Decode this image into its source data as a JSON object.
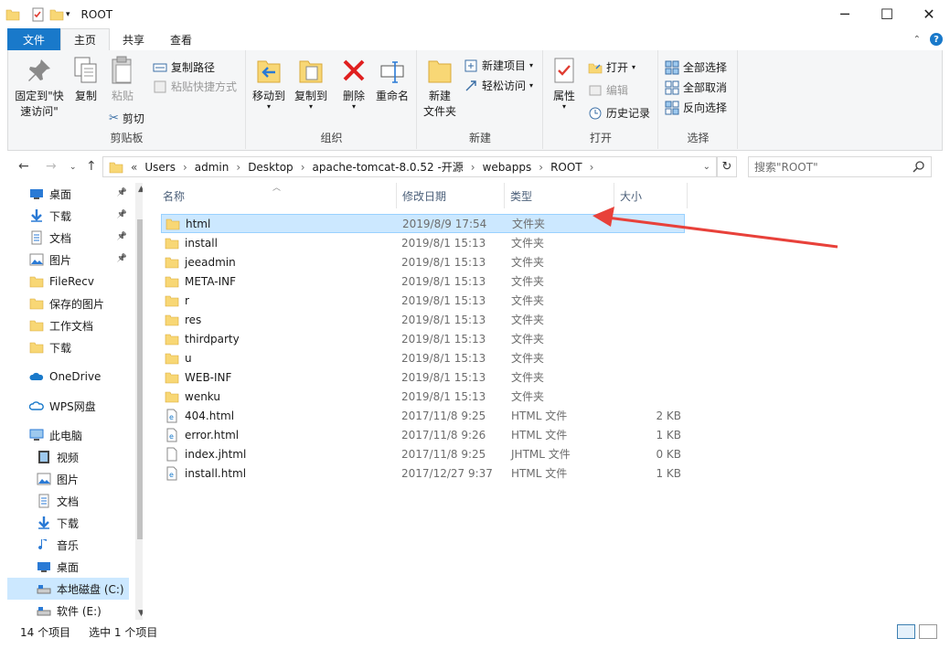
{
  "window": {
    "title": "ROOT",
    "minimize": "─",
    "maximize": "☐",
    "close": "✕"
  },
  "tabs": [
    "文件",
    "主页",
    "共享",
    "查看"
  ],
  "ribbon": {
    "clipboard": {
      "label": "剪贴板",
      "pin": "固定到\"快速访问\"",
      "copy": "复制",
      "paste": "粘贴",
      "copy_path": "复制路径",
      "paste_shortcut": "粘贴快捷方式",
      "cut": "剪切"
    },
    "organize": {
      "label": "组织",
      "move_to": "移动到",
      "copy_to": "复制到",
      "delete": "删除",
      "rename": "重命名"
    },
    "new": {
      "label": "新建",
      "new_folder": "新建\n文件夹",
      "new_item": "新建项目",
      "easy_access": "轻松访问"
    },
    "open": {
      "label": "打开",
      "properties": "属性",
      "open": "打开",
      "edit": "编辑",
      "history": "历史记录"
    },
    "select": {
      "label": "选择",
      "select_all": "全部选择",
      "select_none": "全部取消",
      "invert": "反向选择"
    }
  },
  "address": {
    "prefix": "«",
    "crumbs": [
      "Users",
      "admin",
      "Desktop",
      "apache-tomcat-8.0.52 -开源",
      "webapps",
      "ROOT"
    ],
    "search_placeholder": "搜索\"ROOT\""
  },
  "nav": {
    "quick": [
      {
        "label": "桌面",
        "icon": "desktop-icon",
        "pinned": true
      },
      {
        "label": "下载",
        "icon": "download-icon",
        "pinned": true
      },
      {
        "label": "文档",
        "icon": "document-icon",
        "pinned": true
      },
      {
        "label": "图片",
        "icon": "picture-icon",
        "pinned": true
      },
      {
        "label": "FileRecv",
        "icon": "folder-icon",
        "pinned": false
      },
      {
        "label": "保存的图片",
        "icon": "folder-icon",
        "pinned": false
      },
      {
        "label": "工作文档",
        "icon": "folder-icon",
        "pinned": false
      },
      {
        "label": "下载",
        "icon": "folder-icon",
        "pinned": false
      }
    ],
    "onedrive": "OneDrive",
    "wps": "WPS网盘",
    "thispc": "此电脑",
    "pc": [
      {
        "label": "视频",
        "icon": "video-icon"
      },
      {
        "label": "图片",
        "icon": "picture-icon"
      },
      {
        "label": "文档",
        "icon": "document-icon"
      },
      {
        "label": "下载",
        "icon": "download-icon"
      },
      {
        "label": "音乐",
        "icon": "music-icon"
      },
      {
        "label": "桌面",
        "icon": "desktop-icon"
      },
      {
        "label": "本地磁盘 (C:)",
        "icon": "drive-icon"
      },
      {
        "label": "软件 (E:)",
        "icon": "drive-icon"
      }
    ]
  },
  "columns": [
    "名称",
    "修改日期",
    "类型",
    "大小"
  ],
  "files": [
    {
      "name": "html",
      "date": "2019/8/9 17:54",
      "type": "文件夹",
      "size": "",
      "kind": "folder",
      "selected": true
    },
    {
      "name": "install",
      "date": "2019/8/1 15:13",
      "type": "文件夹",
      "size": "",
      "kind": "folder"
    },
    {
      "name": "jeeadmin",
      "date": "2019/8/1 15:13",
      "type": "文件夹",
      "size": "",
      "kind": "folder"
    },
    {
      "name": "META-INF",
      "date": "2019/8/1 15:13",
      "type": "文件夹",
      "size": "",
      "kind": "folder"
    },
    {
      "name": "r",
      "date": "2019/8/1 15:13",
      "type": "文件夹",
      "size": "",
      "kind": "folder"
    },
    {
      "name": "res",
      "date": "2019/8/1 15:13",
      "type": "文件夹",
      "size": "",
      "kind": "folder"
    },
    {
      "name": "thirdparty",
      "date": "2019/8/1 15:13",
      "type": "文件夹",
      "size": "",
      "kind": "folder"
    },
    {
      "name": "u",
      "date": "2019/8/1 15:13",
      "type": "文件夹",
      "size": "",
      "kind": "folder"
    },
    {
      "name": "WEB-INF",
      "date": "2019/8/1 15:13",
      "type": "文件夹",
      "size": "",
      "kind": "folder"
    },
    {
      "name": "wenku",
      "date": "2019/8/1 15:13",
      "type": "文件夹",
      "size": "",
      "kind": "folder"
    },
    {
      "name": "404.html",
      "date": "2017/11/8 9:25",
      "type": "HTML 文件",
      "size": "2 KB",
      "kind": "html"
    },
    {
      "name": "error.html",
      "date": "2017/11/8 9:26",
      "type": "HTML 文件",
      "size": "1 KB",
      "kind": "html"
    },
    {
      "name": "index.jhtml",
      "date": "2017/11/8 9:25",
      "type": "JHTML 文件",
      "size": "0 KB",
      "kind": "file"
    },
    {
      "name": "install.html",
      "date": "2017/12/27 9:37",
      "type": "HTML 文件",
      "size": "1 KB",
      "kind": "html"
    }
  ],
  "status": {
    "count": "14 个项目",
    "selected": "选中 1 个项目"
  },
  "colors": {
    "accent": "#1979ca",
    "folder": "#f8d775",
    "selection": "#cce8ff",
    "annotation_arrow": "#e8413a"
  }
}
